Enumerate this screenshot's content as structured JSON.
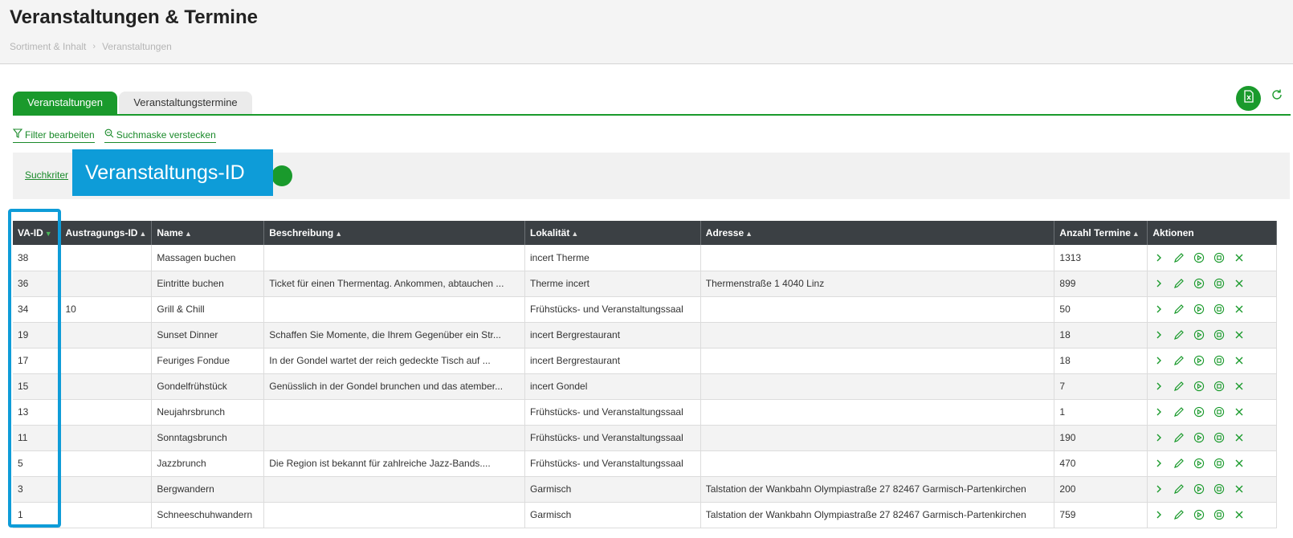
{
  "header": {
    "title": "Veranstaltungen & Termine",
    "breadcrumb": [
      "Sortiment & Inhalt",
      "Veranstaltungen"
    ]
  },
  "tabs": [
    {
      "label": "Veranstaltungen",
      "active": true
    },
    {
      "label": "Veranstaltungstermine",
      "active": false
    }
  ],
  "toolbar": {
    "excel_icon": "excel-export-icon",
    "refresh_icon": "refresh-icon"
  },
  "filters": {
    "edit_label": "Filter bearbeiten",
    "hide_label": "Suchmaske verstecken"
  },
  "search": {
    "link_label": "Suchkriter"
  },
  "callout": {
    "label": "Veranstaltungs-ID"
  },
  "table": {
    "columns": [
      "VA-ID",
      "Austragungs-ID",
      "Name",
      "Beschreibung",
      "Lokalität",
      "Adresse",
      "Anzahl Termine",
      "Aktionen"
    ],
    "rows": [
      {
        "va_id": "38",
        "austragungs_id": "",
        "name": "Massagen buchen",
        "beschreibung": "",
        "lokalitaet": "incert Therme",
        "adresse": "",
        "anzahl": "1313"
      },
      {
        "va_id": "36",
        "austragungs_id": "",
        "name": "Eintritte buchen",
        "beschreibung": "Ticket für einen Thermentag. Ankommen, abtauchen ...",
        "lokalitaet": "Therme incert",
        "adresse": "Thermenstraße 1 4040 Linz",
        "anzahl": "899"
      },
      {
        "va_id": "34",
        "austragungs_id": "10",
        "name": "Grill & Chill",
        "beschreibung": "",
        "lokalitaet": "Frühstücks- und Veranstaltungssaal",
        "adresse": "",
        "anzahl": "50"
      },
      {
        "va_id": "19",
        "austragungs_id": "",
        "name": "Sunset Dinner",
        "beschreibung": "Schaffen Sie Momente, die Ihrem Gegenüber ein Str...",
        "lokalitaet": "incert Bergrestaurant",
        "adresse": "",
        "anzahl": "18"
      },
      {
        "va_id": "17",
        "austragungs_id": "",
        "name": "Feuriges Fondue",
        "beschreibung": "In der Gondel wartet der reich gedeckte Tisch auf ...",
        "lokalitaet": "incert Bergrestaurant",
        "adresse": "",
        "anzahl": "18"
      },
      {
        "va_id": "15",
        "austragungs_id": "",
        "name": "Gondelfrühstück",
        "beschreibung": "Genüsslich in der Gondel brunchen und das atember...",
        "lokalitaet": "incert Gondel",
        "adresse": "",
        "anzahl": "7"
      },
      {
        "va_id": "13",
        "austragungs_id": "",
        "name": "Neujahrsbrunch",
        "beschreibung": "",
        "lokalitaet": "Frühstücks- und Veranstaltungssaal",
        "adresse": "",
        "anzahl": "1"
      },
      {
        "va_id": "11",
        "austragungs_id": "",
        "name": "Sonntagsbrunch",
        "beschreibung": "",
        "lokalitaet": "Frühstücks- und Veranstaltungssaal",
        "adresse": "",
        "anzahl": "190"
      },
      {
        "va_id": "5",
        "austragungs_id": "",
        "name": "Jazzbrunch",
        "beschreibung": "Die Region ist bekannt für zahlreiche Jazz-Bands....",
        "lokalitaet": "Frühstücks- und Veranstaltungssaal",
        "adresse": "",
        "anzahl": "470"
      },
      {
        "va_id": "3",
        "austragungs_id": "",
        "name": "Bergwandern",
        "beschreibung": "",
        "lokalitaet": "Garmisch",
        "adresse": "Talstation der Wankbahn Olympiastraße 27 82467 Garmisch-Partenkirchen",
        "anzahl": "200"
      },
      {
        "va_id": "1",
        "austragungs_id": "",
        "name": "Schneeschuhwandern",
        "beschreibung": "",
        "lokalitaet": "Garmisch",
        "adresse": "Talstation der Wankbahn Olympiastraße 27 82467 Garmisch-Partenkirchen",
        "anzahl": "759"
      }
    ],
    "row_action_icons": [
      "chevron-right-icon",
      "edit-pencil-icon",
      "play-circle-icon",
      "stop-circle-icon",
      "delete-x-icon"
    ]
  },
  "colors": {
    "accent": "#1a9a2c",
    "header_dark": "#3b4044",
    "callout": "#0e9cd8"
  }
}
